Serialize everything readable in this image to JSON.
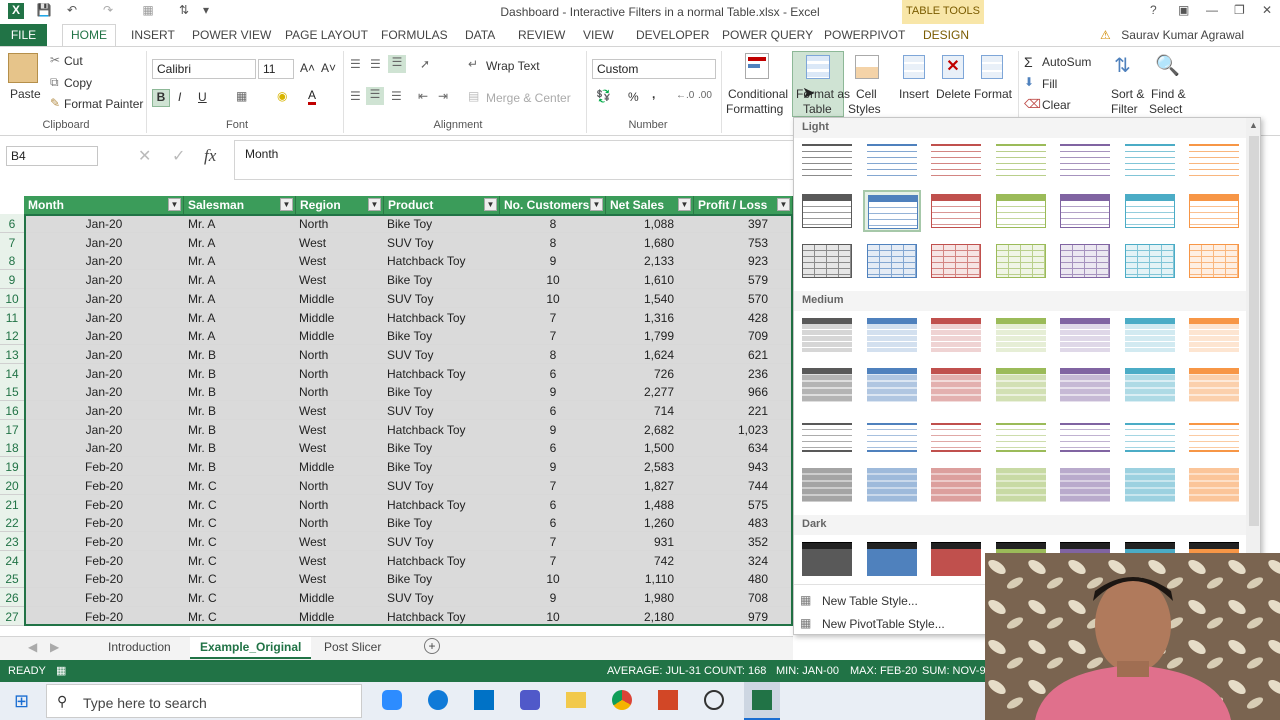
{
  "window": {
    "title": "Dashboard - Interactive Filters in a normal Table.xlsx - Excel",
    "context_tab": "TABLE TOOLS",
    "user": "Saurav Kumar Agrawal"
  },
  "tabs": [
    "FILE",
    "HOME",
    "INSERT",
    "POWER VIEW",
    "PAGE LAYOUT",
    "FORMULAS",
    "DATA",
    "REVIEW",
    "VIEW",
    "DEVELOPER",
    "POWER QUERY",
    "POWERPIVOT",
    "DESIGN"
  ],
  "ribbon": {
    "clipboard": {
      "paste": "Paste",
      "cut": "Cut",
      "copy": "Copy",
      "format_painter": "Format Painter",
      "label": "Clipboard"
    },
    "font": {
      "name": "Calibri",
      "size": "11",
      "bold": "B",
      "italic": "I",
      "underline": "U",
      "label": "Font"
    },
    "alignment": {
      "wrap": "Wrap Text",
      "merge": "Merge & Center",
      "label": "Alignment"
    },
    "number": {
      "format": "Custom",
      "percent": "%",
      "comma": ",",
      "label": "Number"
    },
    "styles": {
      "conditional_line1": "Conditional",
      "conditional_line2": "Formatting",
      "format_table_line1": "Format as",
      "format_table_line2": "Table",
      "cell_line1": "Cell",
      "cell_line2": "Styles"
    },
    "cells": {
      "insert": "Insert",
      "delete": "Delete",
      "format": "Format"
    },
    "editing": {
      "autosum": "AutoSum",
      "fill": "Fill",
      "clear": "Clear",
      "sort_line1": "Sort &",
      "sort_line2": "Filter",
      "find_line1": "Find &",
      "find_line2": "Select"
    }
  },
  "formula_bar": {
    "name_box": "B4",
    "fx": "fx",
    "value": "Month"
  },
  "table": {
    "headers": [
      "Month",
      "Salesman",
      "Region",
      "Product",
      "No. Customers",
      "Net Sales",
      "Profit / Loss"
    ],
    "rows": [
      {
        "n": "6",
        "c": [
          "Jan-20",
          "Mr. A",
          "North",
          "Bike Toy",
          "8",
          "1,088",
          "397"
        ]
      },
      {
        "n": "7",
        "c": [
          "Jan-20",
          "Mr. A",
          "West",
          "SUV Toy",
          "8",
          "1,680",
          "753"
        ]
      },
      {
        "n": "8",
        "c": [
          "Jan-20",
          "Mr. A",
          "West",
          "Hatchback Toy",
          "9",
          "2,133",
          "923"
        ]
      },
      {
        "n": "9",
        "c": [
          "Jan-20",
          "Mr. A",
          "West",
          "Bike Toy",
          "10",
          "1,610",
          "579"
        ]
      },
      {
        "n": "10",
        "c": [
          "Jan-20",
          "Mr. A",
          "Middle",
          "SUV Toy",
          "10",
          "1,540",
          "570"
        ]
      },
      {
        "n": "11",
        "c": [
          "Jan-20",
          "Mr. A",
          "Middle",
          "Hatchback Toy",
          "7",
          "1,316",
          "428"
        ]
      },
      {
        "n": "12",
        "c": [
          "Jan-20",
          "Mr. A",
          "Middle",
          "Bike Toy",
          "7",
          "1,799",
          "709"
        ]
      },
      {
        "n": "13",
        "c": [
          "Jan-20",
          "Mr. B",
          "North",
          "SUV Toy",
          "8",
          "1,624",
          "621"
        ]
      },
      {
        "n": "14",
        "c": [
          "Jan-20",
          "Mr. B",
          "North",
          "Hatchback Toy",
          "6",
          "726",
          "236"
        ]
      },
      {
        "n": "15",
        "c": [
          "Jan-20",
          "Mr. B",
          "North",
          "Bike Toy",
          "9",
          "2,277",
          "966"
        ]
      },
      {
        "n": "16",
        "c": [
          "Jan-20",
          "Mr. B",
          "West",
          "SUV Toy",
          "6",
          "714",
          "221"
        ]
      },
      {
        "n": "17",
        "c": [
          "Jan-20",
          "Mr. B",
          "West",
          "Hatchback Toy",
          "9",
          "2,682",
          "1,023"
        ]
      },
      {
        "n": "18",
        "c": [
          "Jan-20",
          "Mr. B",
          "West",
          "Bike Toy",
          "6",
          "1,500",
          "634"
        ]
      },
      {
        "n": "19",
        "c": [
          "Feb-20",
          "Mr. B",
          "Middle",
          "Bike Toy",
          "9",
          "2,583",
          "943"
        ]
      },
      {
        "n": "20",
        "c": [
          "Feb-20",
          "Mr. C",
          "North",
          "SUV Toy",
          "7",
          "1,827",
          "744"
        ]
      },
      {
        "n": "21",
        "c": [
          "Feb-20",
          "Mr. C",
          "North",
          "Hatchback Toy",
          "6",
          "1,488",
          "575"
        ]
      },
      {
        "n": "22",
        "c": [
          "Feb-20",
          "Mr. C",
          "North",
          "Bike Toy",
          "6",
          "1,260",
          "483"
        ]
      },
      {
        "n": "23",
        "c": [
          "Feb-20",
          "Mr. C",
          "West",
          "SUV Toy",
          "7",
          "931",
          "352"
        ]
      },
      {
        "n": "24",
        "c": [
          "Feb-20",
          "Mr. C",
          "West",
          "Hatchback Toy",
          "7",
          "742",
          "324"
        ]
      },
      {
        "n": "25",
        "c": [
          "Feb-20",
          "Mr. C",
          "West",
          "Bike Toy",
          "10",
          "1,110",
          "480"
        ]
      },
      {
        "n": "26",
        "c": [
          "Feb-20",
          "Mr. C",
          "Middle",
          "SUV Toy",
          "9",
          "1,980",
          "708"
        ]
      },
      {
        "n": "27",
        "c": [
          "Feb-20",
          "Mr. C",
          "Middle",
          "Hatchback Toy",
          "10",
          "2,180",
          "979"
        ]
      }
    ]
  },
  "sheets": [
    "Introduction",
    "Example_Original",
    "Post Slicer"
  ],
  "active_sheet": "Example_Original",
  "status": {
    "mode": "READY",
    "average": "AVERAGE: JUL-31",
    "count": "COUNT: 168",
    "min": "MIN: JAN-00",
    "max": "MAX: FEB-20",
    "sum": "SUM: NOV-9"
  },
  "taskbar": {
    "search_placeholder": "Type here to search"
  },
  "gallery": {
    "sections": [
      "Light",
      "Medium",
      "Dark"
    ],
    "new_table_style": "New Table Style...",
    "new_pivot_style": "New PivotTable Style...",
    "palette": [
      "#595959",
      "#4f81bd",
      "#c0504d",
      "#9bbb59",
      "#8064a2",
      "#4bacc6",
      "#f79646"
    ]
  }
}
